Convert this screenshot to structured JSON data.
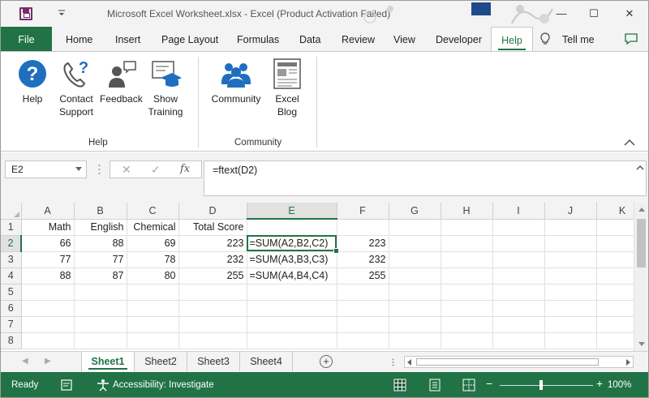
{
  "window": {
    "title": "Microsoft Excel Worksheet.xlsx  -  Excel (Product Activation Failed)",
    "minimize": "—",
    "restore": "☐",
    "close": "✕"
  },
  "tabs": [
    {
      "label": "File"
    },
    {
      "label": "Home"
    },
    {
      "label": "Insert"
    },
    {
      "label": "Page Layout"
    },
    {
      "label": "Formulas"
    },
    {
      "label": "Data"
    },
    {
      "label": "Review"
    },
    {
      "label": "View"
    },
    {
      "label": "Developer"
    },
    {
      "label": "Help"
    }
  ],
  "tell_me": "Tell me",
  "ribbon": {
    "help_group": {
      "label": "Help",
      "buttons": [
        {
          "label": "Help",
          "icon": "help-question-icon"
        },
        {
          "label": "Contact Support",
          "icon": "phone-question-icon"
        },
        {
          "label": "Feedback",
          "icon": "feedback-person-icon"
        },
        {
          "label": "Show Training",
          "icon": "training-cap-icon"
        }
      ]
    },
    "community_group": {
      "label": "Community",
      "buttons": [
        {
          "label": "Community",
          "icon": "people-group-icon"
        },
        {
          "label": "Excel Blog",
          "icon": "blog-page-icon"
        }
      ]
    }
  },
  "formula_bar": {
    "name_box": "E2",
    "cancel": "✕",
    "enter": "✓",
    "fx": "fx",
    "formula": "=ftext(D2)"
  },
  "grid": {
    "columns": [
      "A",
      "B",
      "C",
      "D",
      "E",
      "F",
      "G",
      "H",
      "I",
      "J",
      "K"
    ],
    "rows": [
      {
        "num": "1",
        "cells": [
          "Math",
          "English",
          "Chemical",
          "Total Score",
          "",
          "",
          "",
          "",
          "",
          "",
          ""
        ]
      },
      {
        "num": "2",
        "cells": [
          "66",
          "88",
          "69",
          "223",
          "=SUM(A2,B2,C2)",
          "223",
          "",
          "",
          "",
          "",
          ""
        ]
      },
      {
        "num": "3",
        "cells": [
          "77",
          "77",
          "78",
          "232",
          "=SUM(A3,B3,C3)",
          "232",
          "",
          "",
          "",
          "",
          ""
        ]
      },
      {
        "num": "4",
        "cells": [
          "88",
          "87",
          "80",
          "255",
          "=SUM(A4,B4,C4)",
          "255",
          "",
          "",
          "",
          "",
          ""
        ]
      },
      {
        "num": "5",
        "cells": [
          "",
          "",
          "",
          "",
          "",
          "",
          "",
          "",
          "",
          "",
          ""
        ]
      },
      {
        "num": "6",
        "cells": [
          "",
          "",
          "",
          "",
          "",
          "",
          "",
          "",
          "",
          "",
          ""
        ]
      },
      {
        "num": "7",
        "cells": [
          "",
          "",
          "",
          "",
          "",
          "",
          "",
          "",
          "",
          "",
          ""
        ]
      },
      {
        "num": "8",
        "cells": [
          "",
          "",
          "",
          "",
          "",
          "",
          "",
          "",
          "",
          "",
          ""
        ]
      }
    ],
    "active_cell": "E2"
  },
  "sheets": [
    {
      "label": "Sheet1",
      "active": true
    },
    {
      "label": "Sheet2"
    },
    {
      "label": "Sheet3"
    },
    {
      "label": "Sheet4"
    }
  ],
  "add_sheet": "+",
  "status": {
    "ready": "Ready",
    "accessibility": "Accessibility: Investigate",
    "zoom_minus": "−",
    "zoom_plus": "+",
    "zoom": "100%"
  },
  "colors": {
    "accent": "#217346",
    "help_icon": "#1f6fbf"
  }
}
